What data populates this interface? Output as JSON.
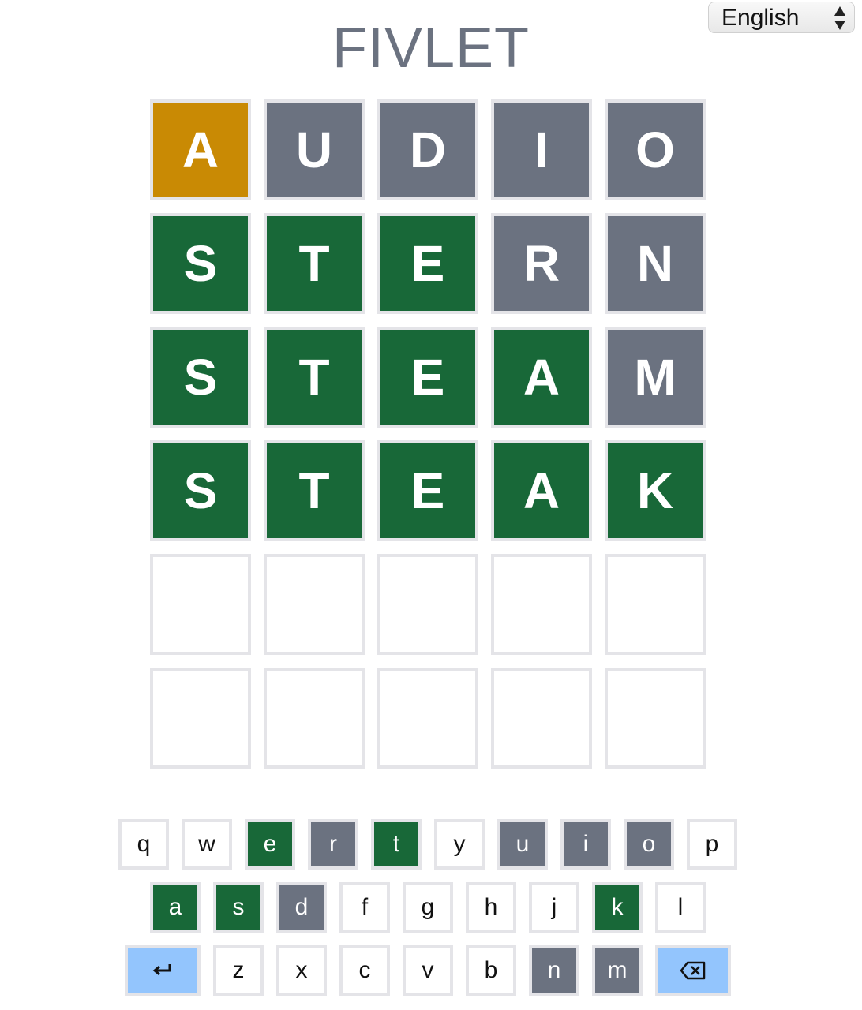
{
  "header": {
    "title": "FIVLET",
    "language": "English"
  },
  "colors": {
    "correct": "#186838",
    "present": "#c98a04",
    "absent": "#6b7280",
    "special_key": "#93c5fd"
  },
  "board": {
    "rows": [
      [
        {
          "letter": "A",
          "state": "present"
        },
        {
          "letter": "U",
          "state": "absent"
        },
        {
          "letter": "D",
          "state": "absent"
        },
        {
          "letter": "I",
          "state": "absent"
        },
        {
          "letter": "O",
          "state": "absent"
        }
      ],
      [
        {
          "letter": "S",
          "state": "correct"
        },
        {
          "letter": "T",
          "state": "correct"
        },
        {
          "letter": "E",
          "state": "correct"
        },
        {
          "letter": "R",
          "state": "absent"
        },
        {
          "letter": "N",
          "state": "absent"
        }
      ],
      [
        {
          "letter": "S",
          "state": "correct"
        },
        {
          "letter": "T",
          "state": "correct"
        },
        {
          "letter": "E",
          "state": "correct"
        },
        {
          "letter": "A",
          "state": "correct"
        },
        {
          "letter": "M",
          "state": "absent"
        }
      ],
      [
        {
          "letter": "S",
          "state": "correct"
        },
        {
          "letter": "T",
          "state": "correct"
        },
        {
          "letter": "E",
          "state": "correct"
        },
        {
          "letter": "A",
          "state": "correct"
        },
        {
          "letter": "K",
          "state": "correct"
        }
      ],
      [
        {
          "letter": "",
          "state": "empty"
        },
        {
          "letter": "",
          "state": "empty"
        },
        {
          "letter": "",
          "state": "empty"
        },
        {
          "letter": "",
          "state": "empty"
        },
        {
          "letter": "",
          "state": "empty"
        }
      ],
      [
        {
          "letter": "",
          "state": "empty"
        },
        {
          "letter": "",
          "state": "empty"
        },
        {
          "letter": "",
          "state": "empty"
        },
        {
          "letter": "",
          "state": "empty"
        },
        {
          "letter": "",
          "state": "empty"
        }
      ]
    ]
  },
  "keyboard": {
    "rows": [
      [
        {
          "label": "q",
          "state": "unused"
        },
        {
          "label": "w",
          "state": "unused"
        },
        {
          "label": "e",
          "state": "correct"
        },
        {
          "label": "r",
          "state": "absent"
        },
        {
          "label": "t",
          "state": "correct"
        },
        {
          "label": "y",
          "state": "unused"
        },
        {
          "label": "u",
          "state": "absent"
        },
        {
          "label": "i",
          "state": "absent"
        },
        {
          "label": "o",
          "state": "absent"
        },
        {
          "label": "p",
          "state": "unused"
        }
      ],
      [
        {
          "label": "a",
          "state": "correct"
        },
        {
          "label": "s",
          "state": "correct"
        },
        {
          "label": "d",
          "state": "absent"
        },
        {
          "label": "f",
          "state": "unused"
        },
        {
          "label": "g",
          "state": "unused"
        },
        {
          "label": "h",
          "state": "unused"
        },
        {
          "label": "j",
          "state": "unused"
        },
        {
          "label": "k",
          "state": "correct"
        },
        {
          "label": "l",
          "state": "unused"
        }
      ],
      [
        {
          "label": "↵",
          "state": "special",
          "icon": "enter-icon"
        },
        {
          "label": "z",
          "state": "unused"
        },
        {
          "label": "x",
          "state": "unused"
        },
        {
          "label": "c",
          "state": "unused"
        },
        {
          "label": "v",
          "state": "unused"
        },
        {
          "label": "b",
          "state": "unused"
        },
        {
          "label": "n",
          "state": "absent"
        },
        {
          "label": "m",
          "state": "absent"
        },
        {
          "label": "",
          "state": "special",
          "icon": "backspace-icon"
        }
      ]
    ]
  }
}
